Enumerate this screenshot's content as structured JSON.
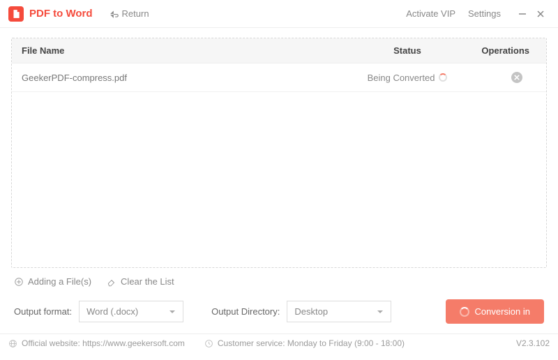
{
  "header": {
    "app_title": "PDF to Word",
    "return_label": "Return",
    "activate_vip": "Activate VIP",
    "settings": "Settings"
  },
  "table": {
    "headers": {
      "name": "File Name",
      "status": "Status",
      "ops": "Operations"
    },
    "rows": [
      {
        "name": "GeekerPDF-compress.pdf",
        "status": "Being Converted"
      }
    ]
  },
  "actions": {
    "add_file": "Adding a File(s)",
    "clear_list": "Clear the List"
  },
  "output": {
    "format_label": "Output format:",
    "format_value": "Word (.docx)",
    "dir_label": "Output Directory:",
    "dir_value": "Desktop"
  },
  "convert_button": "Conversion in",
  "statusbar": {
    "website": "Official website: https://www.geekersoft.com",
    "service": "Customer service: Monday to Friday (9:00 - 18:00)",
    "version": "V2.3.102"
  }
}
